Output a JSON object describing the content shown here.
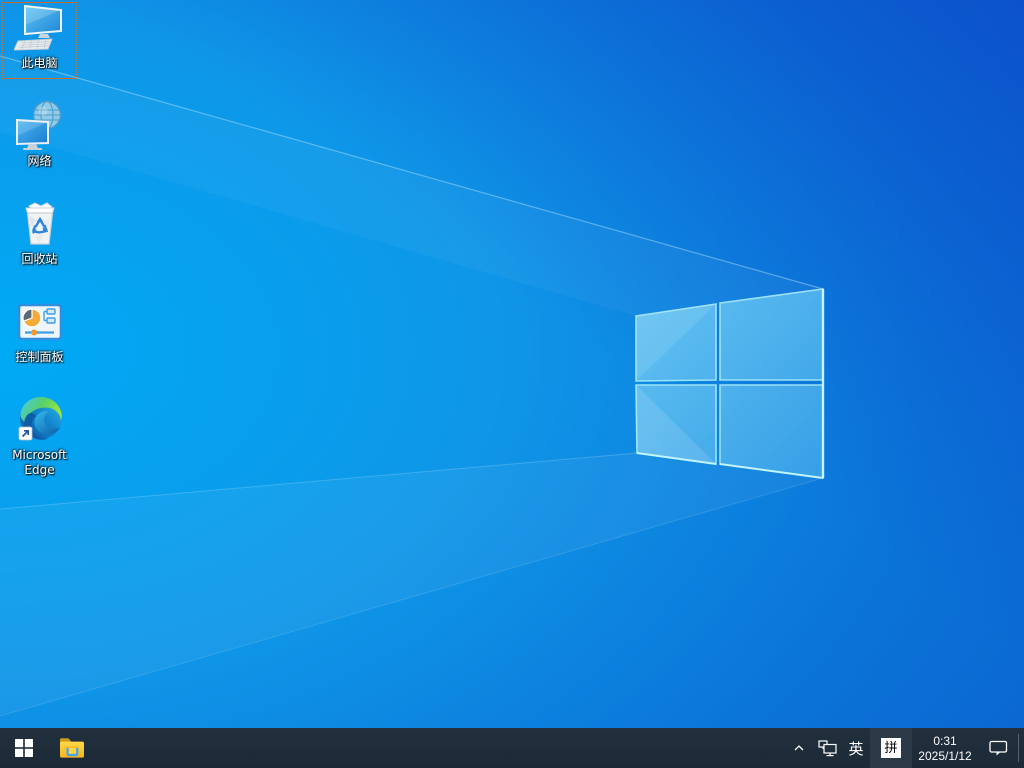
{
  "desktop": {
    "icons": [
      {
        "label": "此电脑",
        "selected": true
      },
      {
        "label": "网络",
        "selected": false
      },
      {
        "label": "回收站",
        "selected": false
      },
      {
        "label": "控制面板",
        "selected": false
      },
      {
        "label": "Microsoft Edge",
        "selected": false,
        "shortcut": true
      }
    ]
  },
  "taskbar": {
    "tray": {
      "language": "英",
      "ime_badge": "拼",
      "time": "0:31",
      "date": "2025/1/12"
    }
  },
  "colors": {
    "wallpaper_light": "#00aaf5",
    "wallpaper_mid": "#0f96e8",
    "wallpaper_deep": "#0b5ccd",
    "taskbar_bg": "#1e2b38",
    "ime_active_bg": "#2c3947",
    "selection_dots": "#d6762c"
  }
}
